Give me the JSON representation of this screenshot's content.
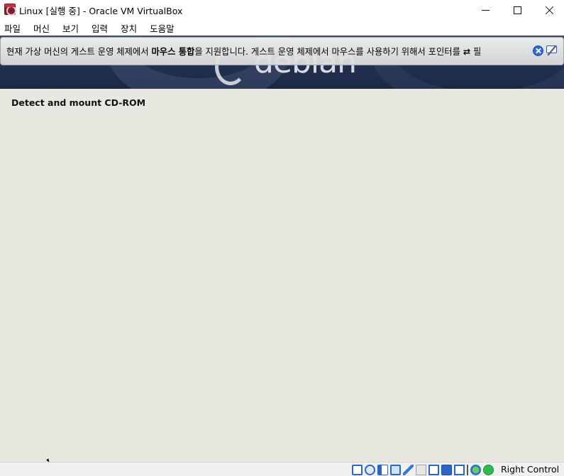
{
  "window": {
    "title": "Linux [실행 중] - Oracle VM VirtualBox"
  },
  "menubar": {
    "items": [
      "파일",
      "머신",
      "보기",
      "입력",
      "장치",
      "도움말"
    ]
  },
  "notice": {
    "text_before": "현재 가상 머신의 게스트 운영 체제에서 ",
    "bold_text": "마우스 통합",
    "text_after": "을 지원합니다. 게스트 운영 체제에서 마우스를 사용하기 위해서 포인터를 ",
    "inline_icon": "⇄",
    "text_end": " 필"
  },
  "installer": {
    "banner_brand": "debian",
    "heading": "Detect and mount CD-ROM"
  },
  "statusbar": {
    "icons": [
      "hard-disk-icon",
      "optical-drive-icon",
      "audio-icon",
      "network-icon",
      "usb-icon",
      "shared-folders-icon",
      "display-icon",
      "video-capture-icon",
      "mouse-capture-icon",
      "mouse-integration-icon",
      "guest-additions-icon"
    ],
    "host_key": "Right Control"
  }
}
